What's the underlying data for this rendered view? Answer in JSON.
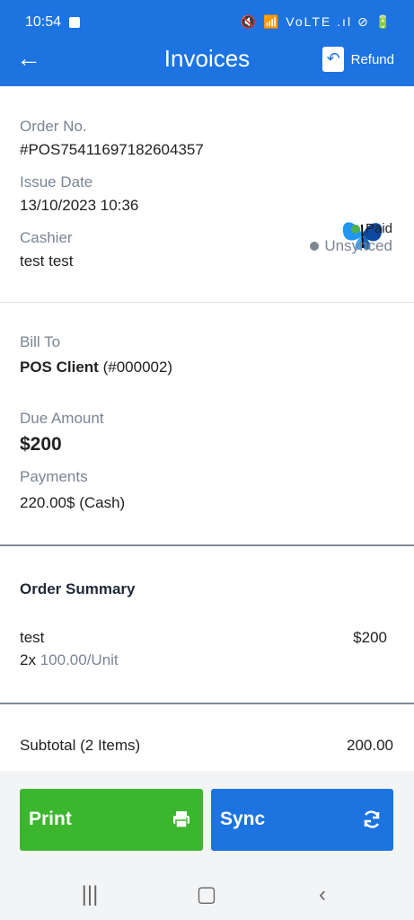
{
  "status_bar": {
    "time": "10:54",
    "icons": "🔇 📶 VoLTE .ıl ⊘ 🔋"
  },
  "app_bar": {
    "title": "Invoices",
    "refund_label": "Refund"
  },
  "invoice": {
    "order_no_label": "Order No.",
    "order_no": "#POS75411697182604357",
    "issue_date_label": "Issue Date",
    "issue_date": "13/10/2023  10:36",
    "cashier_label": "Cashier",
    "cashier": "test test",
    "paid_status": "Paid",
    "sync_status": "Unsynced"
  },
  "billing": {
    "bill_to_label": "Bill To",
    "client_name": "POS Client",
    "client_id": "(#000002)",
    "due_amount_label": "Due Amount",
    "due_amount": "$200",
    "payments_label": "Payments",
    "payment_amount": "220.00$",
    "payment_method": "(Cash)"
  },
  "order_summary": {
    "title": "Order Summary",
    "item_name": "test",
    "item_price": "$200",
    "item_qty": "2x",
    "item_unit": "100.00/Unit"
  },
  "totals": {
    "subtotal_label": "Subtotal (2 Items)",
    "subtotal_value": "200.00"
  },
  "actions": {
    "print_label": "Print",
    "sync_label": "Sync"
  },
  "colors": {
    "primary": "#1d74e0",
    "print": "#3db62f",
    "paid_dot": "#4caf50",
    "unsynced_dot": "#7d8593"
  },
  "icons": {
    "back": "arrow-left-icon",
    "refund": "refund-document-icon",
    "print": "printer-icon",
    "sync": "sync-icon",
    "butterfly": "butterfly-logo",
    "nav_recents": "recent-apps-icon",
    "nav_home": "home-icon",
    "nav_back": "back-icon"
  }
}
